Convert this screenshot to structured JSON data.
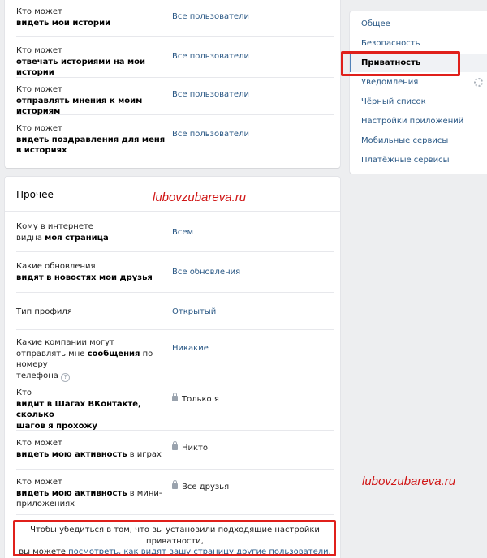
{
  "stories_block": {
    "rows": [
      {
        "label_plain": "Кто может",
        "label_bold": "видеть мои истории",
        "value": "Все пользователи"
      },
      {
        "label_plain": "Кто может",
        "label_bold": "отвечать историями на мои истории",
        "value": "Все пользователи"
      },
      {
        "label_plain": "Кто может",
        "label_bold": "отправлять мнения к моим историям",
        "value": "Все пользователи"
      },
      {
        "label_plain": "Кто может",
        "label_bold_1": "видеть поздравления для меня",
        "label_bold_2": "в историях",
        "value": "Все пользователи"
      }
    ]
  },
  "other_section": {
    "title": "Прочее",
    "rows": [
      {
        "line1": "Кому в интернете",
        "line2_plain": "видна ",
        "line2_bold": "моя страница",
        "value": "Всем"
      },
      {
        "line1": "Какие обновления",
        "line2_bold": "видят в новостях мои друзья",
        "value": "Все обновления"
      },
      {
        "line1": "Тип профиля",
        "value": "Открытый"
      },
      {
        "line1": "Какие компании могут",
        "line2_plain": "отправлять мне ",
        "line2_bold": "сообщения",
        "line2_tail": " по номеру",
        "line3": "телефона",
        "help": "?",
        "value": "Никакие"
      },
      {
        "line1": "Кто",
        "line2_bold": "видит в Шагах ВКонтакте, сколько",
        "line3_bold": "шагов я прохожу",
        "value": "Только я"
      },
      {
        "line1": "Кто может",
        "line2_bold": "видеть мою активность",
        "line2_tail": " в играх",
        "value": "Никто"
      },
      {
        "line1": "Кто может",
        "line2_bold": "видеть мою активность",
        "line2_tail": " в мини-",
        "line3": "приложениях",
        "value": "Все друзья"
      }
    ],
    "note": {
      "line1": "Чтобы убедиться в том, что вы установили подходящие настройки приватности,",
      "line2_plain": "вы можете ",
      "link": "посмотреть, как видят вашу страницу другие пользователи",
      "line2_tail": "."
    }
  },
  "sidebar": {
    "items": [
      {
        "label": "Общее"
      },
      {
        "label": "Безопасность"
      },
      {
        "label": "Приватность"
      },
      {
        "label": "Уведомления"
      },
      {
        "label": "Чёрный список"
      },
      {
        "label": "Настройки приложений"
      },
      {
        "label": "Мобильные сервисы"
      },
      {
        "label": "Платёжные сервисы"
      }
    ],
    "active_index": 2
  },
  "watermarks": [
    "lubovzubareva.ru",
    "lubovzubareva.ru"
  ],
  "colors": {
    "accent": "#2a5885",
    "highlight": "#e0201b",
    "watermark": "#d01616"
  },
  "icons": [
    "lock-icon",
    "help-icon",
    "gear-icon"
  ]
}
